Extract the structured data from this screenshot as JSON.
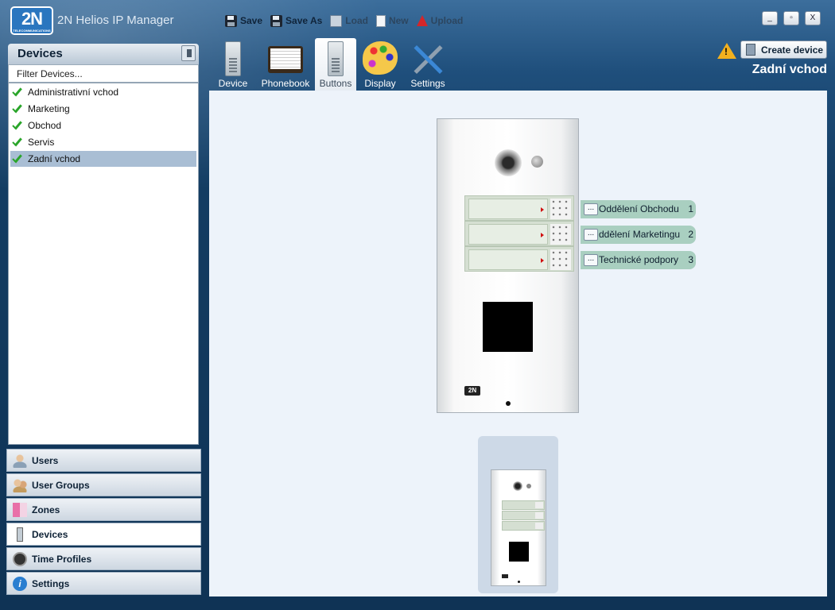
{
  "app": {
    "logo": "2N",
    "logo_sub": "TELECOMMUNICATIONS",
    "title": "2N Helios IP Manager"
  },
  "toolbar": {
    "save": "Save",
    "save_as": "Save As",
    "load": "Load",
    "new": "New",
    "upload": "Upload"
  },
  "window_buttons": {
    "minimize": "_",
    "maximize": "▫",
    "close": "X"
  },
  "devices_panel": {
    "title": "Devices",
    "filter_placeholder": "Filter Devices...",
    "items": [
      {
        "label": "Administrativní vchod",
        "selected": false
      },
      {
        "label": "Marketing",
        "selected": false
      },
      {
        "label": "Obchod",
        "selected": false
      },
      {
        "label": "Servis",
        "selected": false
      },
      {
        "label": "Zadní vchod",
        "selected": true
      }
    ]
  },
  "nav": [
    {
      "label": "Users",
      "icon": "user-icon"
    },
    {
      "label": "User Groups",
      "icon": "user-groups-icon"
    },
    {
      "label": "Zones",
      "icon": "zones-icon"
    },
    {
      "label": "Devices",
      "icon": "device-icon",
      "active": true
    },
    {
      "label": "Time Profiles",
      "icon": "clock-icon"
    },
    {
      "label": "Settings",
      "icon": "info-icon"
    }
  ],
  "tabs": [
    {
      "label": "Device",
      "icon": "intercom-icon"
    },
    {
      "label": "Phonebook",
      "icon": "phonebook-icon"
    },
    {
      "label": "Buttons",
      "icon": "intercom-icon",
      "active": true
    },
    {
      "label": "Display",
      "icon": "palette-icon"
    },
    {
      "label": "Settings",
      "icon": "tools-icon"
    }
  ],
  "header_right": {
    "warning": "!",
    "create_device": "Create device",
    "current_device": "Zadní vchod"
  },
  "buttons_view": {
    "device_logo": "2N",
    "button_labels": [
      {
        "text": "Oddělení Obchodu",
        "number": "1",
        "dots": "..."
      },
      {
        "text": "ddělení Marketingu",
        "number": "2",
        "dots": "..."
      },
      {
        "text": "Technické podpory",
        "number": "3",
        "dots": "..."
      }
    ]
  }
}
